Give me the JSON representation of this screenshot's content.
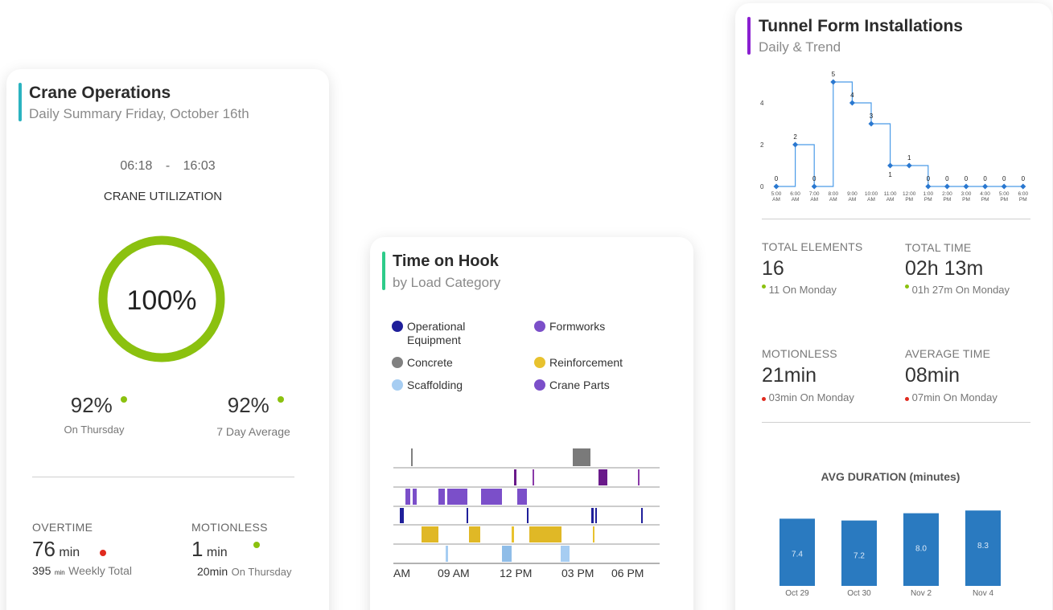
{
  "crane": {
    "title": "Crane Operations",
    "subtitle": "Daily Summary Friday, October 16th",
    "start_time": "06:18",
    "separator": "-",
    "end_time": "16:03",
    "utilization_label": "CRANE UTILIZATION",
    "utilization_value": "100%",
    "utilization_fraction": 1.0,
    "compare": [
      {
        "value": "92%",
        "label": "On Thursday"
      },
      {
        "value": "92%",
        "label": "7 Day Average"
      }
    ],
    "overtime": {
      "label": "OVERTIME",
      "value": "76",
      "unit": "min",
      "sub_value": "395",
      "sub_unit": "min",
      "sub_label": "Weekly Total"
    },
    "motionless": {
      "label": "MOTIONLESS",
      "value": "1",
      "unit": "min",
      "sub_value": "20min",
      "sub_label": "On Thursday"
    },
    "colors": {
      "accent": "#2bb3c0",
      "ring": "#8bc10f",
      "good": "#8bc10f",
      "bad": "#e02a1e"
    }
  },
  "hook": {
    "title": "Time on Hook",
    "subtitle": "by Load Category",
    "legend": [
      {
        "label": "Operational Equipment",
        "color": "#1f1f9a"
      },
      {
        "label": "Formworks",
        "color": "#7b4fc9"
      },
      {
        "label": "Concrete",
        "color": "#808080"
      },
      {
        "label": "Reinforcement",
        "color": "#e8c22e"
      },
      {
        "label": "Scaffolding",
        "color": "#a6cdf2"
      },
      {
        "label": "Crane Parts",
        "color": "#7b4fc9"
      }
    ],
    "axis_ticks": [
      "AM",
      "09 AM",
      "12 PM",
      "03 PM",
      "06 PM"
    ],
    "colors": {
      "accent": "#2ecc8a"
    }
  },
  "tunnel": {
    "title": "Tunnel Form Installations",
    "subtitle": "Daily & Trend",
    "stats": [
      {
        "label": "TOTAL ELEMENTS",
        "value": "16",
        "sub": "11 On Monday",
        "trend": "good"
      },
      {
        "label": "TOTAL TIME",
        "value": "02h 13m",
        "sub": "01h 27m On Monday",
        "trend": "good"
      },
      {
        "label": "MOTIONLESS",
        "value": "21min",
        "sub": "03min On Monday",
        "trend": "bad"
      },
      {
        "label": "AVERAGE TIME",
        "value": "08min",
        "sub": "07min On Monday",
        "trend": "bad"
      }
    ],
    "colors": {
      "accent": "#8a1fd1",
      "line": "#4a9be8",
      "bar": "#2a7ac0"
    }
  },
  "chart_data": [
    {
      "type": "line",
      "x": [
        "5:00 AM",
        "6:00 AM",
        "7:00 AM",
        "8:00 AM",
        "9:00 AM",
        "10:00 AM",
        "11:00 AM",
        "12:00 PM",
        "1:00 PM",
        "2:00 PM",
        "3:00 PM",
        "4:00 PM",
        "5:00 PM",
        "6:00 PM"
      ],
      "values": [
        0,
        2,
        0,
        5,
        4,
        3,
        1,
        1,
        0,
        0,
        0,
        0,
        0,
        0
      ],
      "y_ticks": [
        0,
        2,
        4
      ],
      "ylim": [
        0,
        5
      ],
      "step": true
    },
    {
      "type": "bar",
      "title": "AVG DURATION (minutes)",
      "categories": [
        "Oct 29",
        "Oct 30",
        "Nov 2",
        "Nov 4"
      ],
      "values": [
        7.4,
        7.2,
        8.0,
        8.3
      ],
      "labels": [
        "7.4",
        "7.2",
        "8.0",
        "8.3"
      ]
    }
  ]
}
